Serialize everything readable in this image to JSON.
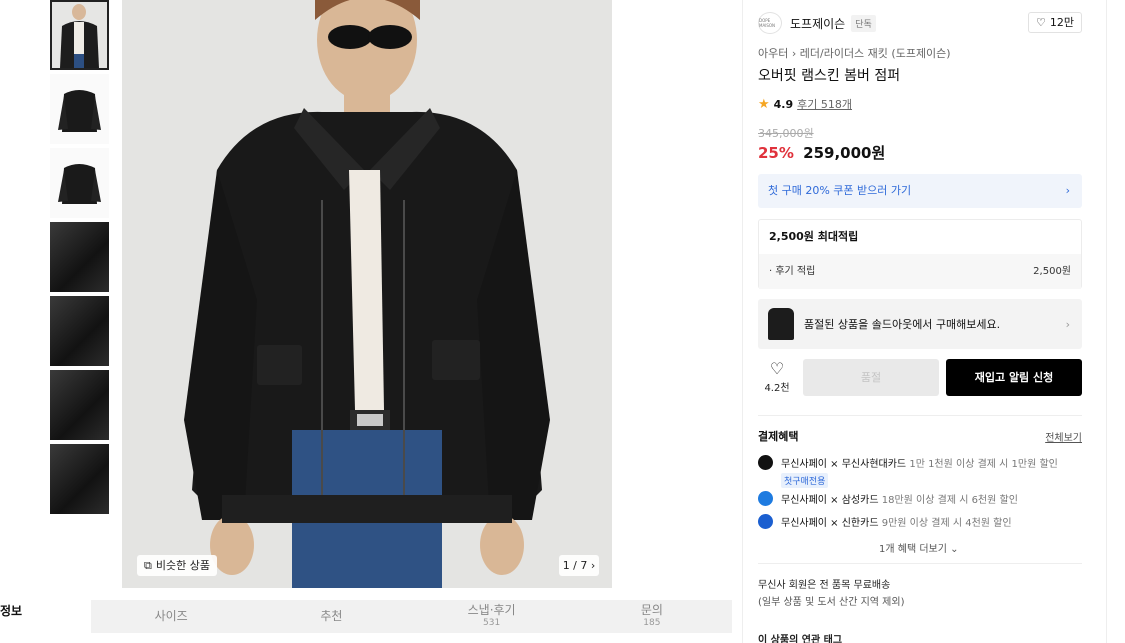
{
  "gallery": {
    "thumbnails": [
      "thumb-1",
      "thumb-2",
      "thumb-3",
      "thumb-4",
      "thumb-5",
      "thumb-6",
      "thumb-7"
    ],
    "similar_label": "비슷한 상품",
    "counter": "1 / 7"
  },
  "tabs": {
    "left_label": "정보",
    "items": [
      {
        "label": "사이즈",
        "sub": ""
      },
      {
        "label": "추천",
        "sub": ""
      },
      {
        "label": "스냅·후기",
        "sub": "531"
      },
      {
        "label": "문의",
        "sub": "185"
      }
    ]
  },
  "product": {
    "brand_logo_text": "DOPE MAISON",
    "brand": "도프제이슨",
    "brand_badge": "단독",
    "likes": "12만",
    "breadcrumb": "아우터 › 레더/라이더스 재킷 (도프제이슨)",
    "title": "오버핏 램스킨 봄버 점퍼",
    "rating": "4.9",
    "reviews": "후기 518개",
    "original_price": "345,000원",
    "discount": "25%",
    "price": "259,000원"
  },
  "coupon": {
    "text": "첫 구매 20% 쿠폰 받으러 가기"
  },
  "points": {
    "header": "2,500원 최대적립",
    "row_label": "· 후기 적립",
    "row_value": "2,500원"
  },
  "soldout": {
    "text": "품절된 상품을 솔드아웃에서 구매해보세요."
  },
  "actions": {
    "wish_count": "4.2천",
    "buy_label": "품절",
    "restock_label": "재입고 알림 신청"
  },
  "payment": {
    "header": "결제혜택",
    "view_all": "전체보기",
    "benefits": [
      {
        "main": "무신사페이 × 무신사현대카드",
        "detail": "1만 1천원 이상 결제 시 1만원 할인",
        "tag": "첫구매전용",
        "color": "#111111"
      },
      {
        "main": "무신사페이 × 삼성카드",
        "detail": "18만원 이상 결제 시 6천원 할인",
        "tag": "",
        "color": "#1e7be0"
      },
      {
        "main": "무신사페이 × 신한카드",
        "detail": "9만원 이상 결제 시 4천원 할인",
        "tag": "",
        "color": "#1b5fd0"
      }
    ],
    "more": "1개 혜택 더보기"
  },
  "shipping": {
    "line1": "무신사 회원은 전 품목 무료배송",
    "line2": "(일부 상품 및 도서 산간 지역 제외)"
  },
  "related": {
    "header": "이 상품의 연관 태그"
  }
}
